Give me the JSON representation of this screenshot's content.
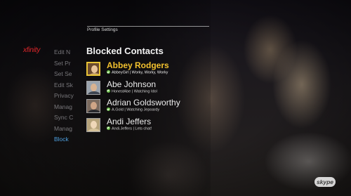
{
  "brand": {
    "logo_text": "xfinity"
  },
  "left_menu": {
    "items": [
      {
        "label": "Edit N",
        "active": false
      },
      {
        "label": "Set Pr",
        "active": false
      },
      {
        "label": "Set Se",
        "active": false
      },
      {
        "label": "Edit Sk",
        "active": false
      },
      {
        "label": "Privacy",
        "active": false
      },
      {
        "label": "Manag",
        "active": false
      },
      {
        "label": "Sync C",
        "active": false
      },
      {
        "label": "Manag",
        "active": false
      },
      {
        "label": "Block",
        "active": true
      }
    ]
  },
  "breadcrumb": "Profile Settings",
  "heading": "Blocked Contacts",
  "contacts": [
    {
      "name": "Abbey Rodgers",
      "status_line": "AbbeyGirl | Worky, Worky, Worky",
      "selected": true,
      "avatar_icon": "user-avatar-icon"
    },
    {
      "name": "Abe Johnson",
      "status_line": "HonestAbe | Watching Idol",
      "selected": false,
      "avatar_icon": "user-avatar-icon"
    },
    {
      "name": "Adrian Goldsworthy",
      "status_line": "A.Gold | Watching Jepoardy",
      "selected": false,
      "avatar_icon": "user-avatar-icon"
    },
    {
      "name": "Andi Jeffers",
      "status_line": "Andi.Jeffers | Lets chat!",
      "selected": false,
      "avatar_icon": "user-avatar-icon"
    }
  ],
  "status_icon": "online-check-icon",
  "skype_logo": "skype",
  "colors": {
    "brand_red": "#e0262a",
    "selected_yellow": "#f2c12e",
    "active_menu_blue": "#4ea0e0",
    "online_green": "#6cc24a"
  }
}
